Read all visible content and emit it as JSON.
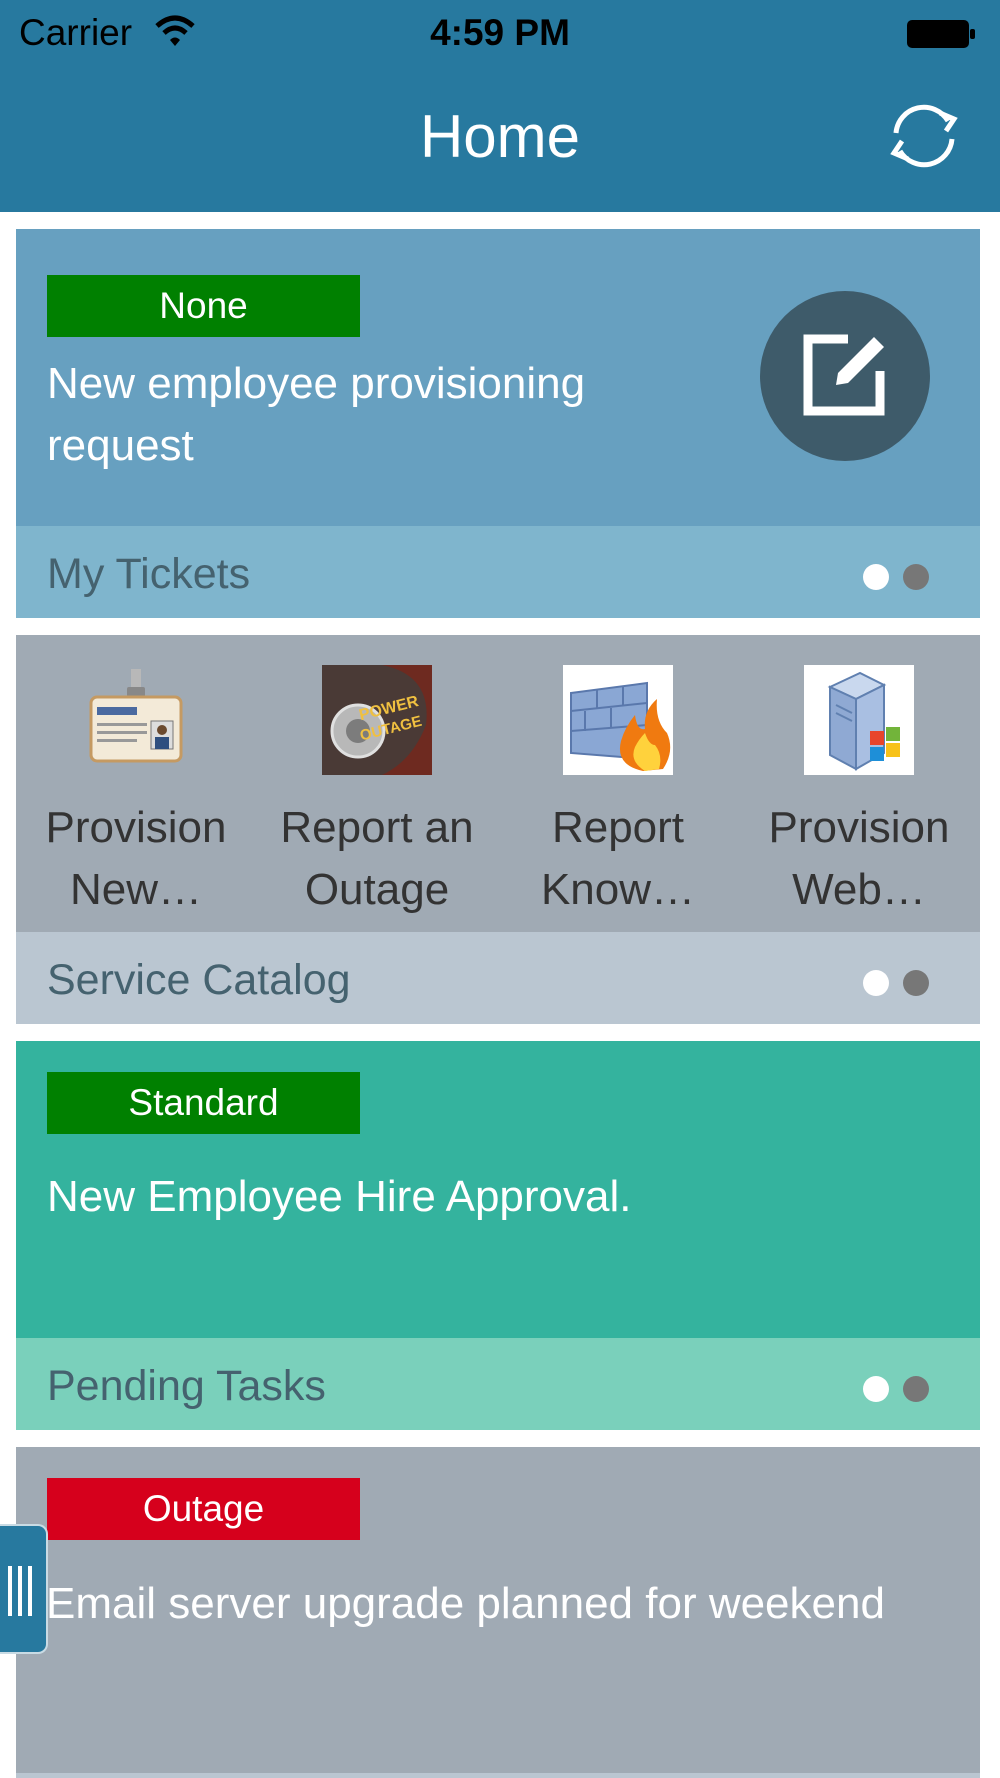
{
  "status_bar": {
    "carrier": "Carrier",
    "time": "4:59 PM"
  },
  "header": {
    "title": "Home",
    "refresh_icon": "refresh-icon"
  },
  "cards": {
    "tickets": {
      "badge": "None",
      "badge_color": "#008000",
      "text_line1": "New employee provisioning",
      "text_line2": "request",
      "footer_label": "My Tickets",
      "body_color": "#67a0c0",
      "footer_color": "#7fb5cd"
    },
    "catalog": {
      "footer_label": "Service Catalog",
      "body_color": "#a0aab4",
      "footer_color": "#bac6d1",
      "items": [
        {
          "line1": "Provision",
          "line2": "New…",
          "icon": "id-badge-icon"
        },
        {
          "line1": "Report an",
          "line2": "Outage",
          "icon": "power-outage-icon"
        },
        {
          "line1": "Report",
          "line2": "Know…",
          "icon": "firewall-icon"
        },
        {
          "line1": "Provision",
          "line2": "Web…",
          "icon": "server-icon"
        }
      ]
    },
    "tasks": {
      "badge": "Standard",
      "badge_color": "#008000",
      "text": "New Employee Hire Approval.",
      "footer_label": "Pending Tasks",
      "body_color": "#34b39e",
      "footer_color": "#7ad0bb"
    },
    "outage": {
      "badge": "Outage",
      "badge_color": "#d6001c",
      "text": "Email server upgrade planned for weekend",
      "body_color": "#a0aab4",
      "footer_color": "#bac6d1"
    }
  }
}
